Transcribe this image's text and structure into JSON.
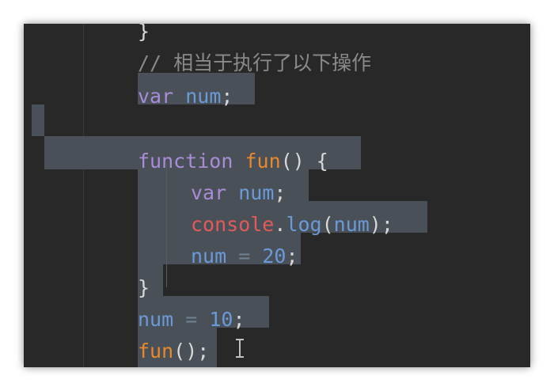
{
  "editor": {
    "lines": [
      {
        "id": "l0",
        "tokens": [
          {
            "c": "pun",
            "t": "}"
          }
        ]
      },
      {
        "id": "l1",
        "tokens": [
          {
            "c": "cmt",
            "t": "// 相当于执行了以下操作"
          }
        ]
      },
      {
        "id": "l2",
        "tokens": [
          {
            "c": "kw",
            "t": "var"
          },
          {
            "c": "pun",
            "t": " "
          },
          {
            "c": "var",
            "t": "num"
          },
          {
            "c": "pun",
            "t": ";"
          }
        ]
      },
      {
        "id": "l3",
        "tokens": []
      },
      {
        "id": "l4",
        "tokens": [
          {
            "c": "kw",
            "t": "function"
          },
          {
            "c": "pun",
            "t": " "
          },
          {
            "c": "fn",
            "t": "fun"
          },
          {
            "c": "pun",
            "t": "() {"
          }
        ]
      },
      {
        "id": "l5",
        "tokens": [
          {
            "c": "kw",
            "t": "var"
          },
          {
            "c": "pun",
            "t": " "
          },
          {
            "c": "var",
            "t": "num"
          },
          {
            "c": "pun",
            "t": ";"
          }
        ]
      },
      {
        "id": "l6",
        "tokens": [
          {
            "c": "con",
            "t": "console"
          },
          {
            "c": "pun",
            "t": "."
          },
          {
            "c": "var",
            "t": "log"
          },
          {
            "c": "pun",
            "t": "("
          },
          {
            "c": "var",
            "t": "num"
          },
          {
            "c": "pun",
            "t": ");"
          }
        ]
      },
      {
        "id": "l7",
        "tokens": [
          {
            "c": "var",
            "t": "num"
          },
          {
            "c": "pun",
            "t": " "
          },
          {
            "c": "op",
            "t": "="
          },
          {
            "c": "pun",
            "t": " "
          },
          {
            "c": "num",
            "t": "20"
          },
          {
            "c": "pun",
            "t": ";"
          }
        ]
      },
      {
        "id": "l8",
        "tokens": [
          {
            "c": "pun",
            "t": "}"
          }
        ]
      },
      {
        "id": "l9",
        "tokens": [
          {
            "c": "var",
            "t": "num"
          },
          {
            "c": "pun",
            "t": " "
          },
          {
            "c": "op",
            "t": "="
          },
          {
            "c": "pun",
            "t": " "
          },
          {
            "c": "num",
            "t": "10"
          },
          {
            "c": "pun",
            "t": ";"
          }
        ]
      },
      {
        "id": "l10",
        "tokens": [
          {
            "c": "fn",
            "t": "fun"
          },
          {
            "c": "pun",
            "t": "();"
          }
        ]
      }
    ]
  },
  "colors": {
    "background": "#282828",
    "selection": "#4a5058",
    "keyword": "#a98cd8",
    "variable": "#6a9ad8",
    "function": "#e8892c",
    "console": "#e25a5a",
    "comment": "#8a8a8a"
  },
  "icons": {
    "cursor": "text-cursor-ibeam-icon"
  }
}
